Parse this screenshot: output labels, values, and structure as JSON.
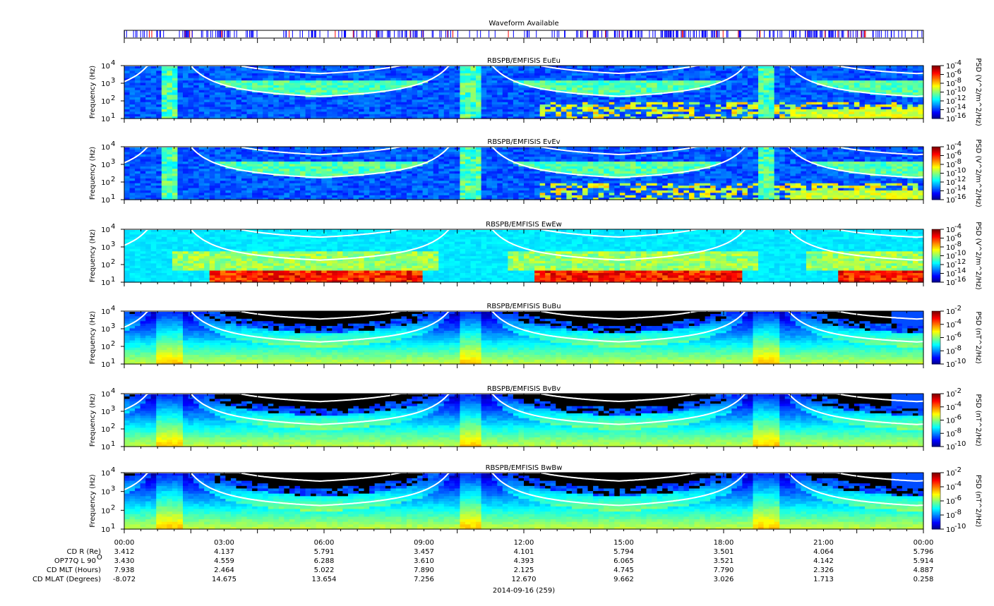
{
  "chart_data": {
    "type": "heatmap",
    "date_label": "2014-09-16 (259)",
    "waveform": {
      "title": "Waveform Available",
      "colors": {
        "burst": "#0000ff",
        "survey": "#ff0000"
      }
    },
    "x_ticks": [
      "00:00",
      "03:00",
      "06:00",
      "09:00",
      "12:00",
      "15:00",
      "18:00",
      "21:00",
      "00:00"
    ],
    "x_range_hours": [
      0,
      24
    ],
    "ephemeris": [
      {
        "label": "CD R (Re)",
        "values": [
          "3.412",
          "4.137",
          "5.791",
          "3.457",
          "4.101",
          "5.794",
          "3.501",
          "4.064",
          "5.796"
        ]
      },
      {
        "label": "OP77Q L 90",
        "sup": "O",
        "values": [
          "3.430",
          "4.559",
          "6.288",
          "3.610",
          "4.393",
          "6.065",
          "3.521",
          "4.142",
          "5.914"
        ]
      },
      {
        "label": "CD MLT (Hours)",
        "values": [
          "7.938",
          "2.464",
          "5.022",
          "7.890",
          "2.125",
          "4.745",
          "7.790",
          "2.326",
          "4.887"
        ]
      },
      {
        "label": "CD MLAT (Degrees)",
        "values": [
          "-8.072",
          "14.675",
          "13.654",
          "7.256",
          "12.670",
          "9.662",
          "3.026",
          "1.713",
          "0.258"
        ]
      }
    ],
    "panels": [
      {
        "title": "RBSPB/EMFISIS  EuEu",
        "ylabel": "Frequency (Hz)",
        "y_ticks": [
          "10",
          "10",
          "10",
          "10"
        ],
        "y_exp": [
          "1",
          "2",
          "3",
          "4"
        ],
        "ylim": [
          10,
          10000
        ],
        "cbar_label": "PSD (V^2/m^2/Hz)",
        "cbar_ticks": [
          "-4",
          "-6",
          "-8",
          "-10",
          "-12",
          "-14",
          "-16"
        ],
        "clim_log": [
          -16,
          -4
        ],
        "kind": "E"
      },
      {
        "title": "RBSPB/EMFISIS  EvEv",
        "ylabel": "Frequency (Hz)",
        "y_ticks": [
          "10",
          "10",
          "10",
          "10"
        ],
        "y_exp": [
          "1",
          "2",
          "3",
          "4"
        ],
        "ylim": [
          10,
          10000
        ],
        "cbar_label": "PSD (V^2/m^2/Hz)",
        "cbar_ticks": [
          "-4",
          "-6",
          "-8",
          "-10",
          "-12",
          "-14",
          "-16"
        ],
        "clim_log": [
          -16,
          -4
        ],
        "kind": "E"
      },
      {
        "title": "RBSPB/EMFISIS  EwEw",
        "ylabel": "Frequency (Hz)",
        "y_ticks": [
          "10",
          "10",
          "10",
          "10"
        ],
        "y_exp": [
          "1",
          "2",
          "3",
          "4"
        ],
        "ylim": [
          10,
          10000
        ],
        "cbar_label": "PSD (V^2/m^2/Hz)",
        "cbar_ticks": [
          "-4",
          "-6",
          "-8",
          "-10",
          "-12",
          "-14",
          "-16"
        ],
        "clim_log": [
          -16,
          -4
        ],
        "kind": "Ew"
      },
      {
        "title": "RBSPB/EMFISIS  BuBu",
        "ylabel": "Frequency (Hz)",
        "y_ticks": [
          "10",
          "10",
          "10",
          "10"
        ],
        "y_exp": [
          "1",
          "2",
          "3",
          "4"
        ],
        "ylim": [
          10,
          10000
        ],
        "cbar_label": "PSD (nT^2/Hz)",
        "cbar_ticks": [
          "-2",
          "-4",
          "-6",
          "-8",
          "-10"
        ],
        "clim_log": [
          -10,
          -2
        ],
        "kind": "B"
      },
      {
        "title": "RBSPB/EMFISIS  BvBv",
        "ylabel": "Frequency (Hz)",
        "y_ticks": [
          "10",
          "10",
          "10",
          "10"
        ],
        "y_exp": [
          "1",
          "2",
          "3",
          "4"
        ],
        "ylim": [
          10,
          10000
        ],
        "cbar_label": "PSD (nT^2/Hz)",
        "cbar_ticks": [
          "-2",
          "-4",
          "-6",
          "-8",
          "-10"
        ],
        "clim_log": [
          -10,
          -2
        ],
        "kind": "B"
      },
      {
        "title": "RBSPB/EMFISIS  BwBw",
        "ylabel": "Frequency (Hz)",
        "y_ticks": [
          "10",
          "10",
          "10",
          "10"
        ],
        "y_exp": [
          "1",
          "2",
          "3",
          "4"
        ],
        "ylim": [
          10,
          10000
        ],
        "cbar_label": "PSD (nT^2/Hz)",
        "cbar_ticks": [
          "-2",
          "-4",
          "-6",
          "-8",
          "-10"
        ],
        "clim_log": [
          -10,
          -2
        ],
        "kind": "B"
      }
    ]
  }
}
